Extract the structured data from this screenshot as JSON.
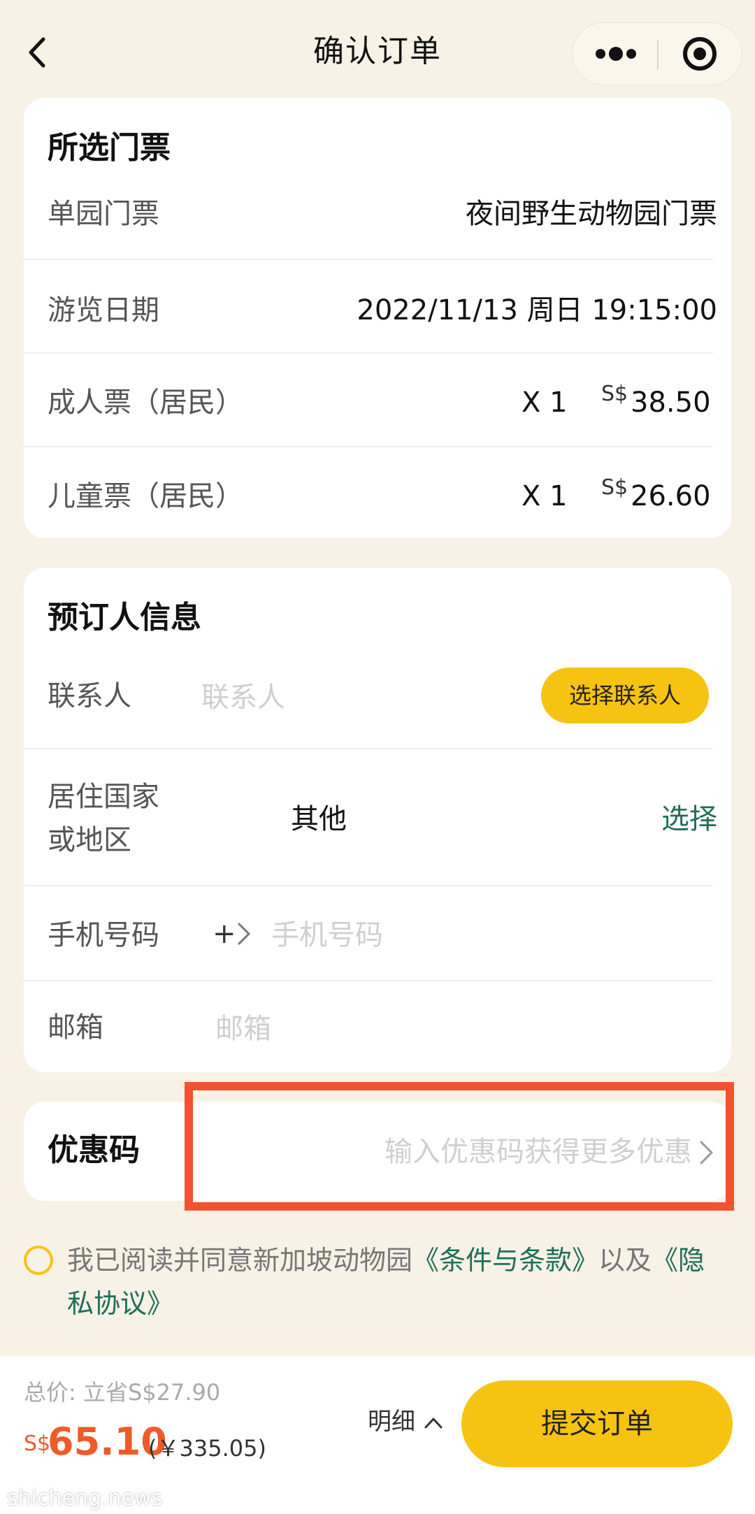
{
  "header": {
    "title": "确认订单",
    "back_icon": "chevron-left-icon",
    "more_icon": "more-dots-icon",
    "target_icon": "target-icon"
  },
  "tickets": {
    "title": "所选门票",
    "rows": [
      {
        "label": "单园门票",
        "value": "夜间野生动物园门票"
      },
      {
        "label": "游览日期",
        "value": "2022/11/13 周日 19:15:00"
      },
      {
        "label": "成人票（居民）",
        "qty": "X 1",
        "currency": "S$",
        "price": "38.50"
      },
      {
        "label": "儿童票（居民）",
        "qty": "X 1",
        "currency": "S$",
        "price": "26.60"
      }
    ]
  },
  "booker": {
    "title": "预订人信息",
    "contact_label": "联系人",
    "contact_placeholder": "联系人",
    "select_contact_button": "选择联系人",
    "country_label_line1": "居住国家",
    "country_label_line2": "或地区",
    "country_value": "其他",
    "country_choose": "选择",
    "phone_label": "手机号码",
    "phone_prefix": "+",
    "phone_placeholder": "手机号码",
    "email_label": "邮箱",
    "email_placeholder": "邮箱"
  },
  "promo": {
    "label": "优惠码",
    "placeholder": "输入优惠码获得更多优惠"
  },
  "agreement": {
    "prefix": "我已阅读并同意新加坡动物园",
    "terms_link": "《条件与条款》",
    "connector": "以及",
    "privacy_link": "《隐私协议》"
  },
  "footer": {
    "total_label": "总价: 立省S$27.90",
    "currency": "S$",
    "total_price": "65.10",
    "cny_price": "(￥335.05)",
    "detail_link": "明细",
    "submit_button": "提交订单"
  },
  "watermark": "shicheng.news",
  "colors": {
    "background": "#f7f1e6",
    "accent_yellow": "#f6c310",
    "link_green": "#1f6f57",
    "price_orange": "#f05a29",
    "highlight_red": "#f2532f"
  }
}
